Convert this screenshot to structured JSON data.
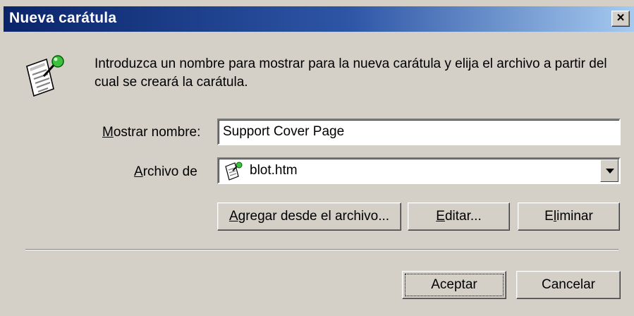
{
  "window": {
    "title": "Nueva carátula",
    "close_label": "×"
  },
  "intro_text": "Introduzca un nombre para mostrar para la nueva carátula y elija el archivo a partir del cual se creará la carátula.",
  "display_name": {
    "label_prefix": "M",
    "label_rest": "ostrar nombre:",
    "value": "Support Cover Page"
  },
  "file": {
    "label_prefix": "A",
    "label_rest": "rchivo de",
    "selected": "blot.htm",
    "icon": "cover-page-document-icon"
  },
  "actions": {
    "add_prefix": "A",
    "add_rest": "gregar desde el archivo...",
    "edit_prefix": "E",
    "edit_rest": "ditar...",
    "delete_before": "E",
    "delete_ul": "l",
    "delete_rest": "iminar"
  },
  "footer": {
    "ok": "Aceptar",
    "cancel": "Cancelar"
  },
  "colors": {
    "dialog_bg": "#d4d0c8",
    "title_start": "#0a246a",
    "title_end": "#a6caf0"
  }
}
